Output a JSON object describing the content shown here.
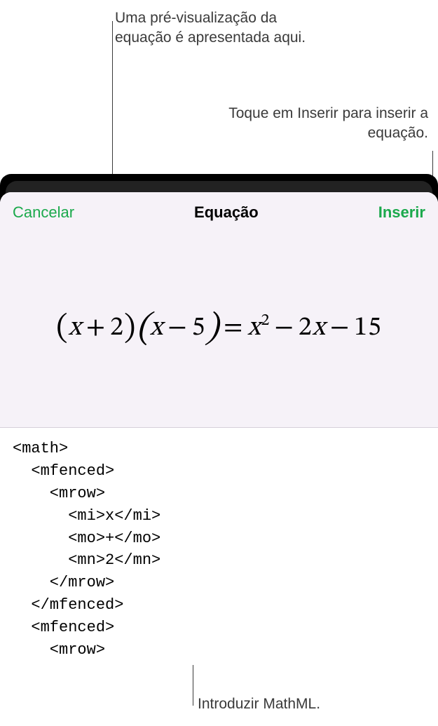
{
  "callouts": {
    "preview": "Uma pré-visualização da equação é apresentada aqui.",
    "insert": "Toque em Inserir para inserir a equação.",
    "mathml": "Introduzir MathML."
  },
  "sheet": {
    "cancel": "Cancelar",
    "title": "Equação",
    "insert": "Inserir"
  },
  "equation": {
    "display": "(x + 2)(x − 5) = x² − 2x − 15"
  },
  "code": "<math>\n  <mfenced>\n    <mrow>\n      <mi>x</mi>\n      <mo>+</mo>\n      <mn>2</mn>\n    </mrow>\n  </mfenced>\n  <mfenced>\n    <mrow>",
  "colors": {
    "accent": "#1ba94c",
    "preview_bg": "#f6f2f8"
  }
}
